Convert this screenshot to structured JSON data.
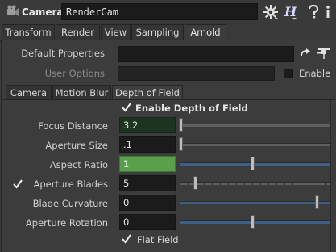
{
  "header": {
    "node_type": "Camera",
    "node_name": "RenderCam"
  },
  "top_tabs": [
    "Transform",
    "Render",
    "View",
    "Sampling",
    "Arnold"
  ],
  "active_top_tab": "Arnold",
  "properties": {
    "default_properties_label": "Default Properties",
    "default_properties_value": "",
    "user_options_label": "User Options",
    "user_options_value": "",
    "enable_label": "Enable"
  },
  "sub_tabs": [
    "Camera",
    "Motion Blur",
    "Depth of Field"
  ],
  "active_sub_tab": "Depth of Field",
  "dof": {
    "enable_label": "Enable Depth of Field",
    "enable_checked": true,
    "focus_distance_label": "Focus Distance",
    "focus_distance_value": "3.2",
    "focus_distance_level": 0,
    "aperture_size_label": "Aperture Size",
    "aperture_size_value": ".1",
    "aperture_size_level": 0,
    "aspect_ratio_label": "Aspect Ratio",
    "aspect_ratio_value": "1",
    "aspect_ratio_level": 0.5,
    "aperture_blades_label": "Aperture Blades",
    "aperture_blades_value": "5",
    "aperture_blades_checked": true,
    "aperture_blades_level": 0.1,
    "blade_curvature_label": "Blade Curvature",
    "blade_curvature_value": "0",
    "blade_curvature_level": 0.95,
    "aperture_rotation_label": "Aperture Rotation",
    "aperture_rotation_value": "0",
    "aperture_rotation_level": 0.5,
    "flat_field_label": "Flat Field",
    "flat_field_checked": true
  },
  "colors": {
    "background": "#3a3a3a",
    "field": "#1b1b1b",
    "green_active": "#5aa04c",
    "green_dark": "#1d3420",
    "slider_blue": "#3e5f86"
  }
}
